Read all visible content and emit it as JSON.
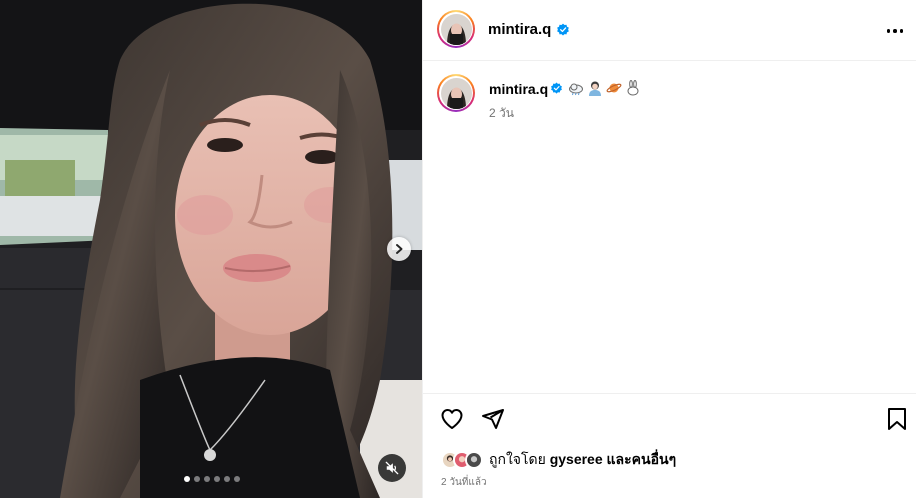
{
  "post": {
    "username": "mintira.q",
    "verified": true,
    "emojis": [
      "cloud-icon",
      "person-icon",
      "planet-icon",
      "rabbit-icon"
    ],
    "caption_time": "2 วัน",
    "liked_prefix": "ถูกใจโดย",
    "liked_user": "gyseree",
    "liked_suffix": "และคนอื่นๆ",
    "post_time": "2 วันที่แล้ว"
  },
  "carousel": {
    "slide_count": 6,
    "active_index": 0
  },
  "colors": {
    "verified_blue": "#0095f6",
    "muted_text": "#737373",
    "divider": "#efefef"
  }
}
